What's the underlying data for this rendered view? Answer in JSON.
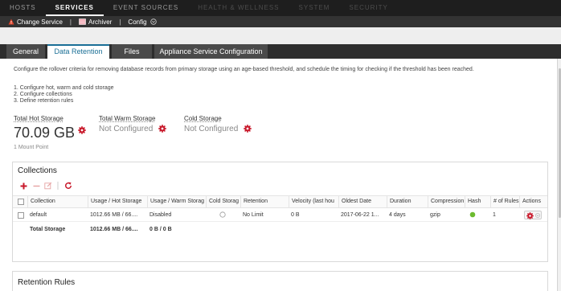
{
  "topnav": {
    "items": [
      "HOSTS",
      "SERVICES",
      "EVENT SOURCES",
      "HEALTH & WELLNESS",
      "SYSTEM",
      "SECURITY"
    ],
    "active": "SERVICES"
  },
  "toolbar": {
    "change_service": "Change Service",
    "separator": "|",
    "archiver": "Archiver",
    "config": "Config"
  },
  "tabs": [
    "General",
    "Data Retention",
    "Files",
    "Appliance Service Configuration"
  ],
  "active_tab": "Data Retention",
  "description": "Configure the rollover criteria for removing database records from primary storage using an age-based threshold, and schedule the timing for checking if the threshold has been reached.",
  "steps": [
    "1. Configure hot, warm and cold storage",
    "2. Configure collections",
    "3. Define retention rules"
  ],
  "stats": {
    "hot": {
      "label": "Total Hot Storage",
      "value": "70.09 GB"
    },
    "warm": {
      "label": "Total Warm Storage",
      "value": "Not Configured"
    },
    "cold": {
      "label": "Cold Storage",
      "value": "Not Configured"
    },
    "mount_point": "1 Mount Point"
  },
  "collections": {
    "title": "Collections",
    "columns": [
      "Collection",
      "Usage / Hot Storage",
      "Usage / Warm Storag",
      "Cold Storag",
      "Retention",
      "Velocity (last hou",
      "Oldest Date",
      "Duration",
      "Compression",
      "Hash",
      "# of Rules",
      "Actions"
    ],
    "rows": [
      {
        "collection": "default",
        "usage_hot": "1012.66 MB / 66....",
        "usage_warm": "Disabled",
        "retention": "No Limit",
        "velocity": "0 B",
        "oldest_date": "2017-06-22 1...",
        "duration": "4 days",
        "compression": "gzip",
        "rules": "1"
      }
    ],
    "total": {
      "label": "Total Storage",
      "usage_hot": "1012.66 MB / 66....",
      "usage_warm": "0 B / 0 B"
    }
  },
  "retention_rules": {
    "title": "Retention Rules"
  },
  "colors": {
    "accent": "#1a6f96",
    "danger": "#c8192b",
    "success": "#6cbb2f",
    "nav_bg": "#1e1e1e",
    "toolbar_bg": "#333333"
  }
}
